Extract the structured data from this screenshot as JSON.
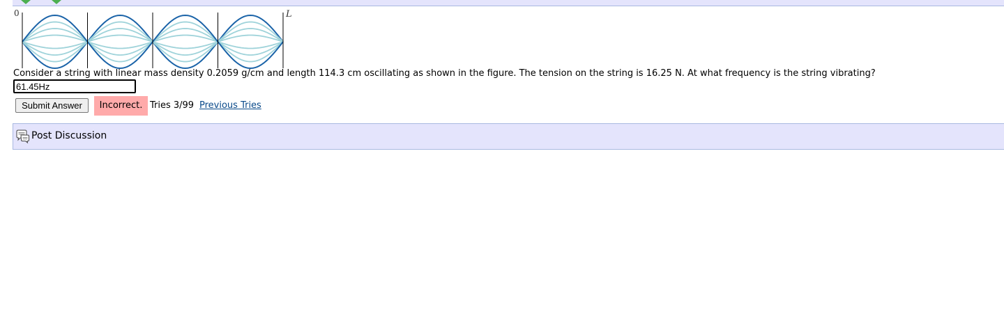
{
  "nav": {
    "prev_icon": "green-left-arrow-icon",
    "next_icon": "green-right-arrow-icon"
  },
  "figure": {
    "label_start": "0",
    "label_end": "L",
    "harmonic_loops": 4,
    "colors": {
      "envelope": "#1a63a8",
      "intermediate": "#9fd3da",
      "boundary": "#000000"
    }
  },
  "problem": {
    "question": "Consider a string with linear mass density 0.2059 g/cm and length 114.3 cm oscillating as shown in the figure. The tension on the string is 16.25 N. At what frequency is the string vibrating?",
    "answer_value": "61.45Hz"
  },
  "controls": {
    "submit_label": "Submit Answer",
    "status": "Incorrect.",
    "status_color": "#ffaaaa",
    "tries": "Tries 3/99",
    "previous_tries": "Previous Tries"
  },
  "discussion": {
    "icon": "discussion-bubble-icon",
    "label": "Post Discussion"
  }
}
